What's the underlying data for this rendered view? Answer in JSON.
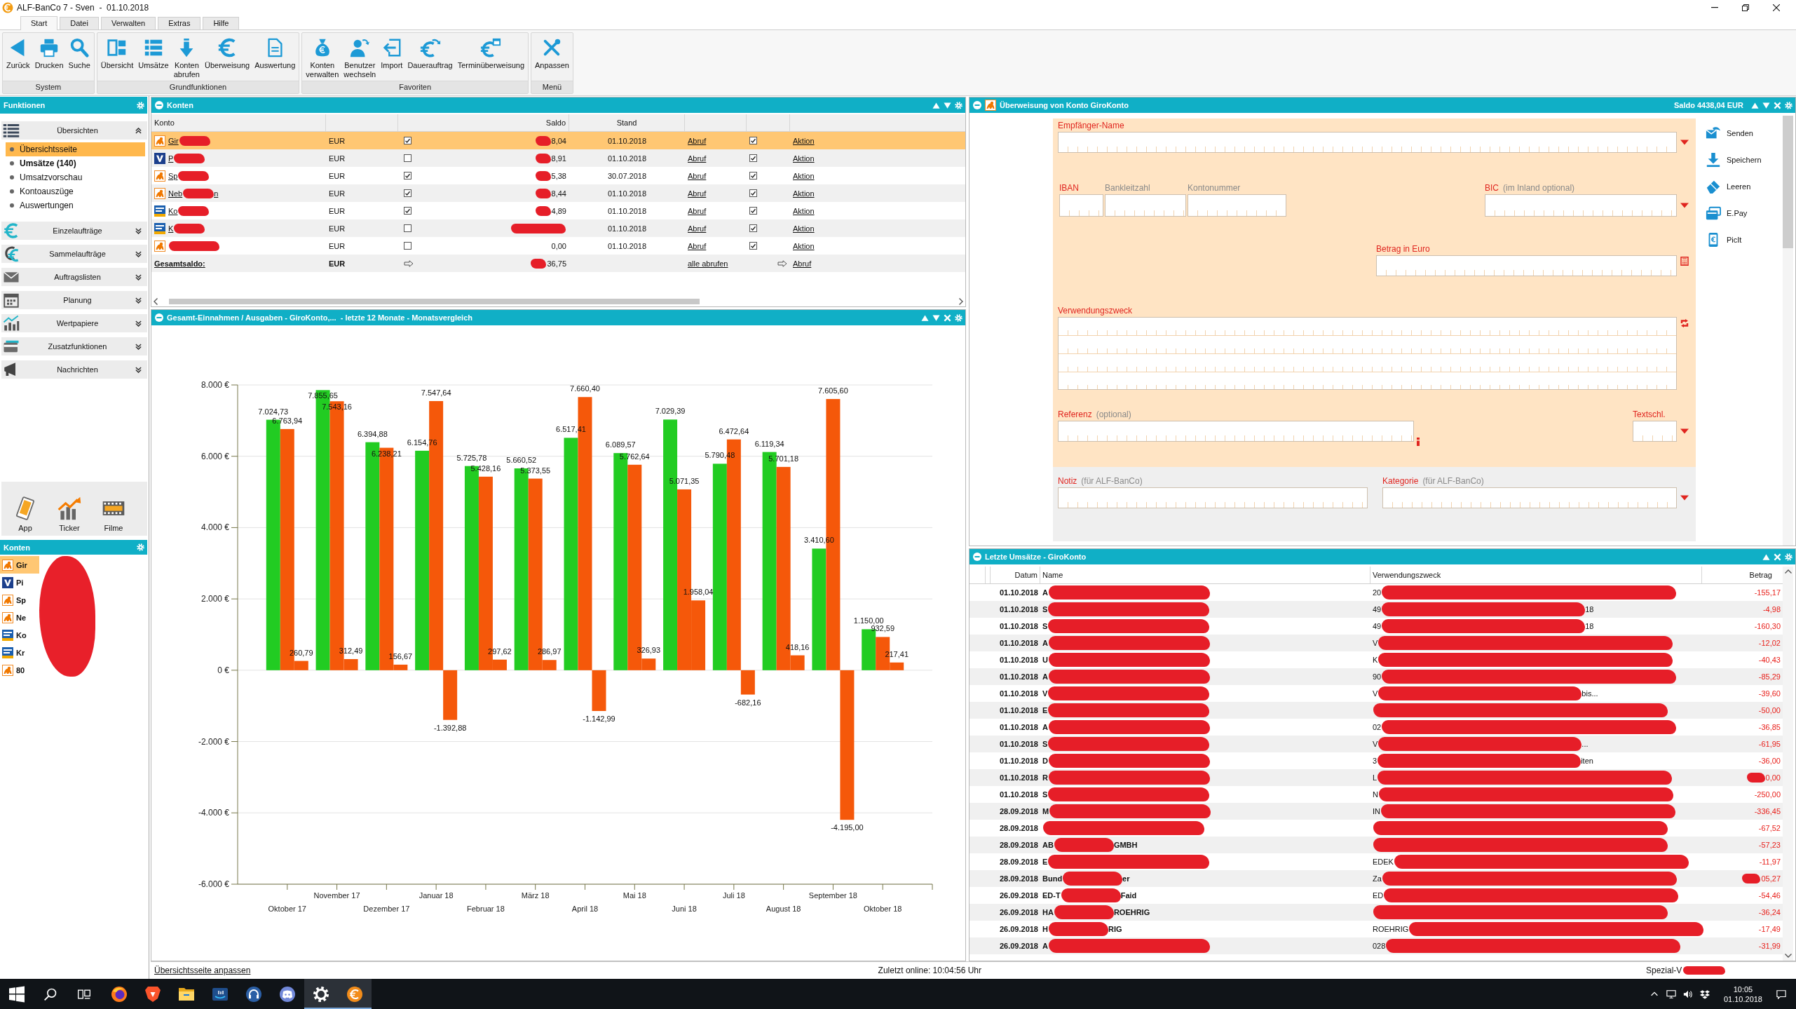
{
  "window": {
    "title": "ALF-BanCo 7 - Sven  -  01.10.2018"
  },
  "tabs": [
    {
      "label": "Start",
      "selected": true
    },
    {
      "label": "Datei",
      "selected": false
    },
    {
      "label": "Verwalten",
      "selected": false
    },
    {
      "label": "Extras",
      "selected": false
    },
    {
      "label": "Hilfe",
      "selected": false
    }
  ],
  "ribbon": [
    {
      "label": "System",
      "buttons": [
        {
          "kind": "back",
          "label": "Zurück"
        },
        {
          "kind": "print",
          "label": "Drucken"
        },
        {
          "kind": "search",
          "label": "Suche"
        }
      ]
    },
    {
      "label": "Grundfunktionen",
      "buttons": [
        {
          "kind": "overview",
          "label": "Übersicht"
        },
        {
          "kind": "list",
          "label": "Umsätze"
        },
        {
          "kind": "fetch",
          "label": "Konten\nabrufen"
        },
        {
          "kind": "euro",
          "label": "Überweisung"
        },
        {
          "kind": "report",
          "label": "Auswertung"
        }
      ]
    },
    {
      "label": "Favoriten",
      "buttons": [
        {
          "kind": "bag",
          "label": "Konten\nverwalten"
        },
        {
          "kind": "user",
          "label": "Benutzer\nwechseln"
        },
        {
          "kind": "import",
          "label": "Import"
        },
        {
          "kind": "standing",
          "label": "Dauerauftrag"
        },
        {
          "kind": "scheduled",
          "label": "Terminüberweisung"
        }
      ]
    },
    {
      "label": "Menü",
      "buttons": [
        {
          "kind": "tools",
          "label": "Anpassen"
        }
      ]
    }
  ],
  "sidebar": {
    "title": "Funktionen",
    "sections": [
      {
        "kind": "overview",
        "label": "Übersichten",
        "expanded": true,
        "items": [
          {
            "label": "Übersichtsseite",
            "selected": true,
            "unread": false
          },
          {
            "label": "Umsätze (140)",
            "selected": false,
            "unread": true
          },
          {
            "label": "Umsatzvorschau",
            "selected": false,
            "unread": false
          },
          {
            "label": "Kontoauszüge",
            "selected": false,
            "unread": false
          },
          {
            "label": "Auswertungen",
            "selected": false,
            "unread": false
          }
        ]
      },
      {
        "kind": "single",
        "label": "Einzelaufträge",
        "expanded": false
      },
      {
        "kind": "collective",
        "label": "Sammelaufträge",
        "expanded": false
      },
      {
        "kind": "lists",
        "label": "Auftragslisten",
        "expanded": false
      },
      {
        "kind": "planning",
        "label": "Planung",
        "expanded": false
      },
      {
        "kind": "securities",
        "label": "Wertpapiere",
        "expanded": false
      },
      {
        "kind": "extras",
        "label": "Zusatzfunktionen",
        "expanded": false
      },
      {
        "kind": "messages",
        "label": "Nachrichten",
        "expanded": false
      }
    ],
    "tiles": [
      {
        "kind": "app",
        "label": "App"
      },
      {
        "kind": "ticker",
        "label": "Ticker"
      },
      {
        "kind": "films",
        "label": "Filme"
      }
    ],
    "accounts": {
      "title": "Konten",
      "items": [
        {
          "kind": "lion",
          "name": "Gir",
          "selected": true
        },
        {
          "kind": "v",
          "name": "Pi",
          "selected": false
        },
        {
          "kind": "lion",
          "name": "Sp",
          "selected": false
        },
        {
          "kind": "lion",
          "name": "Ne",
          "selected": false
        },
        {
          "kind": "bank",
          "name": "Ko",
          "selected": false
        },
        {
          "kind": "bank",
          "name": "Kr",
          "selected": false
        },
        {
          "kind": "lion",
          "name": "80",
          "selected": false
        }
      ]
    }
  },
  "accounts_table": {
    "title": "Konten",
    "columns": [
      "Konto",
      "Saldo",
      "Stand"
    ],
    "rows": [
      {
        "kind": "lion",
        "name": "Gir",
        "currency": "EUR",
        "column_3_checked": true,
        "saldo": "8,04",
        "saldo_redacted": true,
        "stand": "01.10.2018",
        "fetch": "Abruf",
        "column_7_checked": true,
        "action": "Aktion",
        "selected": true
      },
      {
        "kind": "v",
        "name": "P",
        "currency": "EUR",
        "column_3_checked": false,
        "saldo": "8,91",
        "saldo_redacted": true,
        "stand": "01.10.2018",
        "fetch": "Abruf",
        "column_7_checked": true,
        "action": "Aktion",
        "selected": false
      },
      {
        "kind": "lion",
        "name": "Sp",
        "currency": "EUR",
        "column_3_checked": true,
        "saldo": "5,38",
        "saldo_redacted": true,
        "stand": "30.07.2018",
        "fetch": "Abruf",
        "column_7_checked": true,
        "action": "Aktion",
        "selected": false
      },
      {
        "kind": "lion",
        "name": "Neb",
        "name_tail": "n",
        "currency": "EUR",
        "column_3_checked": true,
        "saldo": "8,44",
        "saldo_redacted": true,
        "stand": "01.10.2018",
        "fetch": "Abruf",
        "column_7_checked": true,
        "action": "Aktion",
        "selected": false
      },
      {
        "kind": "bank",
        "name": "Ko",
        "currency": "EUR",
        "column_3_checked": true,
        "saldo": "4,89",
        "saldo_redacted": true,
        "stand": "01.10.2018",
        "fetch": "Abruf",
        "column_7_checked": true,
        "action": "Aktion",
        "selected": false
      },
      {
        "kind": "bank",
        "name": "K",
        "currency": "EUR",
        "column_3_checked": false,
        "saldo_redacted": true,
        "stand": "01.10.2018",
        "fetch": "Abruf",
        "column_7_checked": true,
        "action": "Aktion",
        "selected": false
      },
      {
        "kind": "lion",
        "currency": "EUR",
        "column_3_checked": false,
        "saldo": "0,00",
        "saldo_redacted": false,
        "stand": "01.10.2018",
        "fetch": "Abruf",
        "column_7_checked": true,
        "action": "Aktion",
        "selected": false
      }
    ],
    "total": {
      "label": "Gesamtsaldo:",
      "currency": "EUR",
      "saldo": "36,75",
      "saldo_redacted": true,
      "fetch_all": "alle abrufen",
      "fetch": "Abruf"
    }
  },
  "chart_panel": {
    "title": "Gesamt-Einnahmen / Ausgaben - GiroKonto,...  - letzte 12 Monate - Monatsvergleich",
    "chart_data": {
      "type": "bar",
      "categories": [
        "Oktober 17",
        "November 17",
        "Dezember 17",
        "Januar 18",
        "Februar 18",
        "März 18",
        "April 18",
        "Mai 18",
        "Juni 18",
        "Juli 18",
        "August 18",
        "September 18",
        "Oktober 18"
      ],
      "series": [
        {
          "color": "#22cc22",
          "values": [
            7024.73,
            7855.65,
            6394.88,
            6154.76,
            5725.78,
            5660.52,
            6517.41,
            6089.57,
            7029.39,
            5790.48,
            6119.34,
            3410.6,
            1150.0
          ]
        },
        {
          "color": "#f5580a",
          "values": [
            6763.94,
            7543.16,
            6238.21,
            7547.64,
            5428.16,
            5373.55,
            7660.4,
            5762.64,
            5071.35,
            6472.64,
            5701.18,
            7605.6,
            932.59
          ]
        },
        {
          "color": "#f5580a",
          "values": [
            260.79,
            312.49,
            156.67,
            -1392.88,
            297.62,
            286.97,
            -1142.99,
            326.93,
            1958.04,
            -682.16,
            418.16,
            -4195.0,
            217.41
          ]
        }
      ],
      "ylim": [
        -6000,
        8000
      ],
      "yticks": [
        {
          "value": -6000,
          "label": "-6.000 €"
        },
        {
          "value": -4000,
          "label": "-4.000 €"
        },
        {
          "value": -2000,
          "label": "-2.000 €"
        },
        {
          "value": 0,
          "label": "0 €"
        },
        {
          "value": 2000,
          "label": "2.000 €"
        },
        {
          "value": 4000,
          "label": "4.000 €"
        },
        {
          "value": 6000,
          "label": "6.000 €"
        },
        {
          "value": 8000,
          "label": "8.000 €"
        }
      ],
      "grid": true,
      "value_labels": [
        [
          "7.024,73",
          "7.855,65",
          "6.394,88",
          "6.154,76",
          "5.725,78",
          "5.660,52",
          "6.517,41",
          "6.089,57",
          "7.029,39",
          "5.790,48",
          "6.119,34",
          "3.410,60",
          "1.150,00"
        ],
        [
          "6.763,94",
          "7.543,16",
          "6.238,21",
          "7.547,64",
          "5.428,16",
          "5.373,55",
          "7.660,40",
          "5.762,64",
          "5.071,35",
          "6.472,64",
          "5.701,18",
          "7.605,60",
          "932,59"
        ],
        [
          "260,79",
          "312,49",
          "156,67",
          "-1.392,88",
          "297,62",
          "286,97",
          "-1.142,99",
          "326,93",
          "1.958,04",
          "-682,16",
          "418,16",
          "-4.195,00",
          "217,41"
        ]
      ]
    }
  },
  "transfer": {
    "title": "Überweisung von Konto GiroKonto",
    "balance": "Saldo 4438,04 EUR",
    "fields": {
      "recipient": {
        "label": "Empfänger-Name",
        "disabled": false
      },
      "iban": {
        "label": "IBAN",
        "disabled": false
      },
      "bank_code": {
        "label": "Bankleitzahl",
        "disabled": true
      },
      "account_number": {
        "label": "Kontonummer",
        "disabled": true
      },
      "bic": {
        "label": "BIC",
        "hint": "(im Inland optional)",
        "disabled": false
      },
      "amount": {
        "label": "Betrag in Euro",
        "disabled": false
      },
      "purpose": {
        "label": "Verwendungszweck",
        "disabled": false
      },
      "reference": {
        "label": "Referenz",
        "hint": "(optional)",
        "disabled": false
      },
      "text_key": {
        "label": "Textschl.",
        "disabled": false
      },
      "note": {
        "label": "Notiz",
        "hint": "(für ALF-BanCo)",
        "disabled": false
      },
      "category": {
        "label": "Kategorie",
        "hint": "(für ALF-BanCo)",
        "disabled": false
      }
    },
    "actions": [
      {
        "kind": "send",
        "label": "Senden"
      },
      {
        "kind": "save",
        "label": "Speichern"
      },
      {
        "kind": "clear",
        "label": "Leeren"
      },
      {
        "kind": "epay",
        "label": "E.Pay"
      },
      {
        "kind": "picit",
        "label": "PicIt"
      }
    ]
  },
  "transactions": {
    "title": "Letzte Umsätze - GiroKonto",
    "columns": [
      "Datum",
      "Name",
      "Verwendungszweck",
      "Betrag"
    ],
    "rows": [
      {
        "date": "01.10.2018",
        "name": "A",
        "purpose": "20",
        "amount": "-155,17",
        "amount_redacted": false
      },
      {
        "date": "01.10.2018",
        "name": "S",
        "purpose": "49",
        "purpose_tail": "18",
        "amount": "-4,98",
        "amount_redacted": false
      },
      {
        "date": "01.10.2018",
        "name": "S",
        "purpose": "49",
        "purpose_tail": "18",
        "amount": "-160,30",
        "amount_redacted": false
      },
      {
        "date": "01.10.2018",
        "name": "A",
        "purpose": "V",
        "amount": "-12,02",
        "amount_redacted": false
      },
      {
        "date": "01.10.2018",
        "name": "U",
        "purpose": "K",
        "amount": "-40,43",
        "amount_redacted": false
      },
      {
        "date": "01.10.2018",
        "name": "A",
        "purpose": "90",
        "amount": "-85,29",
        "amount_redacted": false
      },
      {
        "date": "01.10.2018",
        "name": "V",
        "purpose": "V",
        "purpose_tail": "bis...",
        "amount": "-39,60",
        "amount_redacted": false
      },
      {
        "date": "01.10.2018",
        "name": "E",
        "amount": "-50,00",
        "amount_redacted": false
      },
      {
        "date": "01.10.2018",
        "name": "A",
        "purpose": "02",
        "amount": "-36,85",
        "amount_redacted": false
      },
      {
        "date": "01.10.2018",
        "name": "S",
        "purpose": "V",
        "purpose_tail": "...",
        "amount": "-61,95",
        "amount_redacted": false
      },
      {
        "date": "01.10.2018",
        "name": "D",
        "purpose": "3",
        "purpose_tail": "iten",
        "amount": "-36,00",
        "amount_redacted": false
      },
      {
        "date": "01.10.2018",
        "name": "R",
        "purpose": "L",
        "amount": "0,00",
        "amount_redacted": true
      },
      {
        "date": "01.10.2018",
        "name": "S",
        "purpose": "N",
        "amount": "-250,00",
        "amount_redacted": false
      },
      {
        "date": "28.09.2018",
        "name": "M",
        "purpose": "IN",
        "amount": "-336,45",
        "amount_redacted": false
      },
      {
        "date": "28.09.2018",
        "amount": "-67,52",
        "amount_redacted": false
      },
      {
        "date": "28.09.2018",
        "name": "AB",
        "name_tail": "GMBH",
        "amount": "-57,23",
        "amount_redacted": false
      },
      {
        "date": "28.09.2018",
        "name": "E",
        "purpose": "EDEK",
        "amount": "-11,97",
        "amount_redacted": false
      },
      {
        "date": "28.09.2018",
        "name": "Bund",
        "name_tail": "er",
        "purpose": "Za",
        "amount": "05,27",
        "amount_redacted": true
      },
      {
        "date": "26.09.2018",
        "name": "ED-T",
        "name_tail": "Faid",
        "purpose": "ED",
        "amount": "-54,46",
        "amount_redacted": false
      },
      {
        "date": "26.09.2018",
        "name": "HA",
        "name_tail": "ROEHRIG",
        "amount": "-36,24",
        "amount_redacted": false
      },
      {
        "date": "26.09.2018",
        "name": "H",
        "name_tail": "RIG",
        "purpose": "ROEHRIG",
        "amount": "-17,49",
        "amount_redacted": false
      },
      {
        "date": "26.09.2018",
        "name": "A",
        "purpose": "028",
        "amount": "-31,99",
        "amount_redacted": false
      }
    ]
  },
  "status_bar": {
    "link": "Übersichtsseite anpassen",
    "last_online": "Zuletzt online: 10:04:56 Uhr",
    "info": "Spezial-V"
  },
  "taskbar": {
    "apps": [
      {
        "kind": "firefox",
        "active": false
      },
      {
        "kind": "brave",
        "active": false
      },
      {
        "kind": "explorer",
        "active": false
      },
      {
        "kind": "music",
        "active": false
      },
      {
        "kind": "headset",
        "active": false
      },
      {
        "kind": "discord",
        "active": false
      },
      {
        "kind": "settings",
        "active": true
      },
      {
        "kind": "alf",
        "active": true
      }
    ],
    "time": "10:05",
    "date": "01.10.2018"
  }
}
